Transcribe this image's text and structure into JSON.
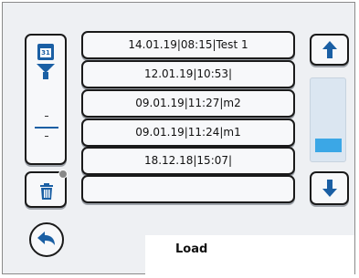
{
  "title": "Load",
  "filter_panel": {
    "calendar_icon_text": "31",
    "funnel_icon": "filter-icon"
  },
  "entries": [
    "14.01.19|08:15|Test 1",
    "12.01.19|10:53|",
    "09.01.19|11:27|m2",
    "09.01.19|11:24|m1",
    "18.12.18|15:07|",
    ""
  ],
  "scrollbar": {
    "position": 0.9
  },
  "icons": {
    "up": "arrow-up-icon",
    "down": "arrow-down-icon",
    "delete": "trash-icon",
    "back": "back-arrow-icon"
  },
  "colors": {
    "accent": "#1a5fa4",
    "scroll_thumb": "#3ba7e6"
  }
}
